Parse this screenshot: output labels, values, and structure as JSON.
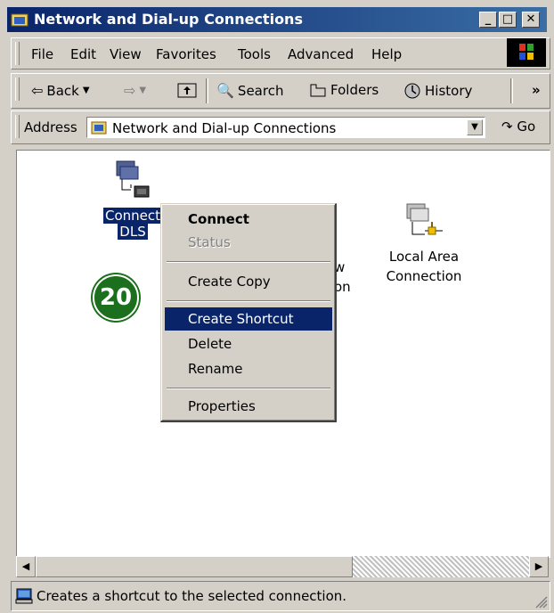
{
  "window": {
    "title": "Network and Dial-up Connections",
    "controls": {
      "minimize": "_",
      "maximize": "□",
      "close": "✕"
    }
  },
  "menu": [
    "File",
    "Edit",
    "View",
    "Favorites",
    "Tools",
    "Advanced",
    "Help"
  ],
  "toolbar": {
    "back": "Back",
    "search": "Search",
    "folders": "Folders",
    "history": "History",
    "more": "»"
  },
  "address": {
    "label": "Address",
    "value": "Network and Dial-up Connections",
    "go": "Go"
  },
  "items": [
    {
      "line1": "Connect",
      "line2": "DLS",
      "selected": true,
      "icon": "dialup-connection-icon"
    },
    {
      "line1": "w",
      "line2": "on",
      "selected": false,
      "icon": "make-new-connection-icon"
    },
    {
      "line1": "Local Area",
      "line2": "Connection",
      "selected": false,
      "icon": "lan-connection-icon"
    }
  ],
  "context_menu": {
    "connect": "Connect",
    "status": "Status",
    "create_copy": "Create Copy",
    "create_shortcut": "Create Shortcut",
    "delete": "Delete",
    "rename": "Rename",
    "properties": "Properties"
  },
  "badge": "20",
  "status": "Creates a shortcut to the selected connection.",
  "colors": {
    "titlebar": "#0a246a",
    "highlight": "#0a246a",
    "chrome": "#d4d0c8",
    "badge": "#1c6f1c"
  }
}
